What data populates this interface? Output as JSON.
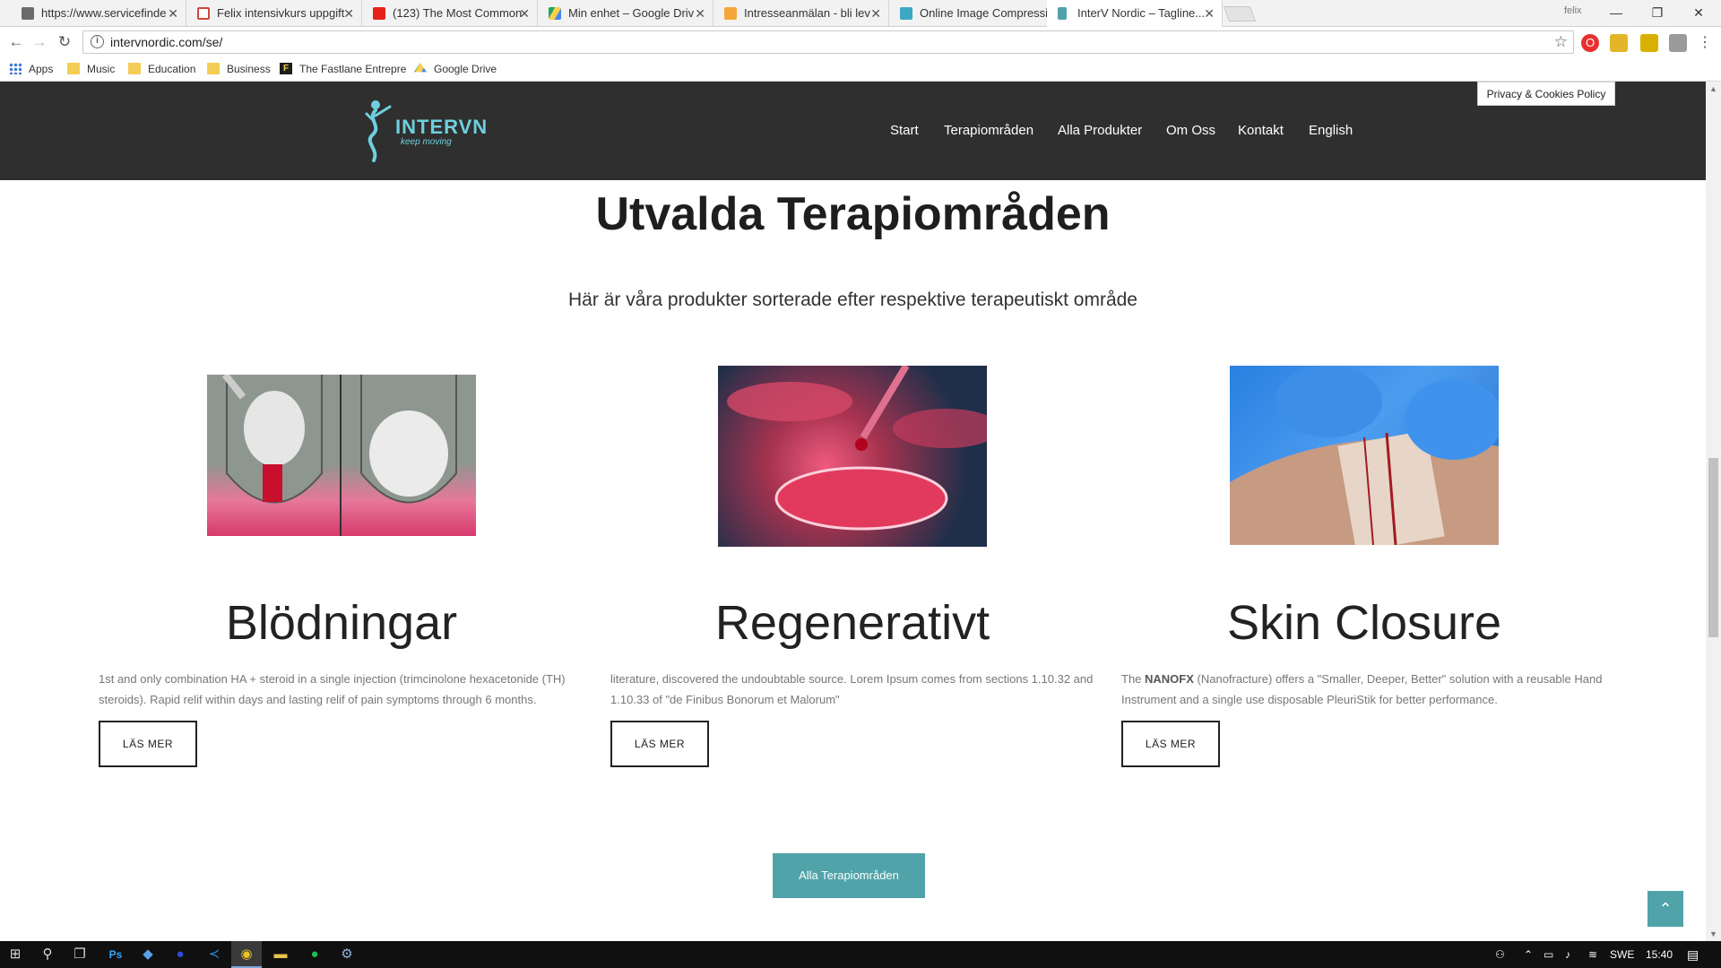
{
  "browser": {
    "tabs": [
      {
        "title": "https://www.servicefinde",
        "favicon_color": "#6b6b6b"
      },
      {
        "title": "Felix intensivkurs uppgift",
        "favicon_color": "#d44638"
      },
      {
        "title": "(123) The Most Common",
        "favicon_color": "#e62117"
      },
      {
        "title": "Min enhet – Google Driv",
        "favicon_color": "#1fa463"
      },
      {
        "title": "Intresseanmälan - bli lev",
        "favicon_color": "#f4a63a"
      },
      {
        "title": "Online Image Compressi",
        "favicon_color": "#3ba9c4"
      },
      {
        "title": "InterV Nordic – Tagline...",
        "favicon_color": "#4fa3a9",
        "active": true
      }
    ],
    "user_label": "felix",
    "address": "intervnordic.com/se/",
    "bookmarks": [
      {
        "label": "Apps",
        "icon": "apps-grid-icon"
      },
      {
        "label": "Music",
        "icon": "folder-icon"
      },
      {
        "label": "Education",
        "icon": "folder-icon"
      },
      {
        "label": "Business",
        "icon": "folder-icon"
      },
      {
        "label": "The Fastlane Entrepre",
        "icon": "fastlane-icon"
      },
      {
        "label": "Google Drive",
        "icon": "google-drive-icon"
      }
    ]
  },
  "site": {
    "logo_text": "INTERVN",
    "logo_tagline": "keep moving",
    "nav": [
      "Start",
      "Terapiområden",
      "Alla Produkter",
      "Om Oss",
      "Kontakt",
      "English"
    ],
    "privacy_label": "Privacy & Cookies Policy",
    "section_title": "Utvalda Terapiområden",
    "section_subtitle": "Här är våra produkter sorterade efter respektive terapeutiskt område",
    "cards": [
      {
        "title": "Blödningar",
        "text": "1st and only combination HA + steroid in a single injection (trimcinolone hexacetonide (TH) steroids). Rapid relif within days and lasting relif of pain symptoms through 6 months.",
        "button": "LÄS MER"
      },
      {
        "title": "Regenerativt",
        "text": "literature, discovered the undoubtable source. Lorem Ipsum comes from sections 1.10.32 and 1.10.33 of \"de Finibus Bonorum et Malorum\"",
        "button": "LÄS MER"
      },
      {
        "title": "Skin Closure",
        "text_prefix": "The ",
        "text_bold": "NANOFX",
        "text_rest": " (Nanofracture) offers a \"Smaller, Deeper, Better\" solution with a reusable Hand Instrument and a single use disposable PleuriStik for better performance.",
        "button": "LÄS MER"
      }
    ],
    "all_button": "Alla Terapiområden",
    "accent_color": "#4fa3a9"
  },
  "taskbar": {
    "language": "SWE",
    "time": "15:40"
  }
}
